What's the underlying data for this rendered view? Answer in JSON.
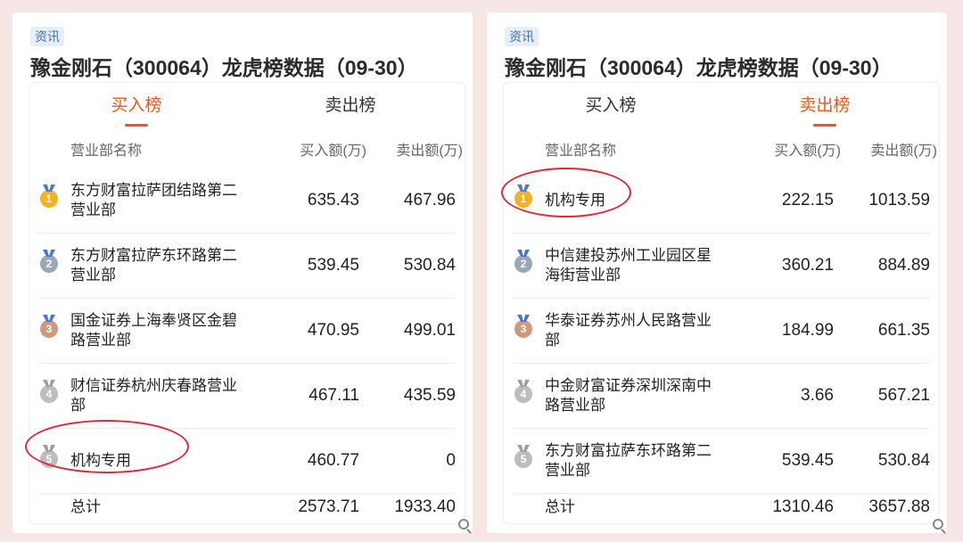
{
  "left_panel": {
    "tag": "资讯",
    "title": "豫金刚石（300064）龙虎榜数据（09-30）",
    "tabs": [
      "买入榜",
      "卖出榜"
    ],
    "active_tab": 0,
    "headers": {
      "name": "营业部名称",
      "buy": "买入额(万)",
      "sell": "卖出额(万)"
    },
    "rows": [
      {
        "rank": "1",
        "name": "东方财富拉萨团结路第二营业部",
        "buy": "635.43",
        "sell": "467.96"
      },
      {
        "rank": "2",
        "name": "东方财富拉萨东环路第二营业部",
        "buy": "539.45",
        "sell": "530.84"
      },
      {
        "rank": "3",
        "name": "国金证券上海奉贤区金碧路营业部",
        "buy": "470.95",
        "sell": "499.01"
      },
      {
        "rank": "4",
        "name": "财信证券杭州庆春路营业部",
        "buy": "467.11",
        "sell": "435.59"
      },
      {
        "rank": "5",
        "name": "机构专用",
        "buy": "460.77",
        "sell": "0"
      }
    ],
    "total": {
      "label": "总计",
      "buy": "2573.71",
      "sell": "1933.40"
    }
  },
  "right_panel": {
    "tag": "资讯",
    "title": "豫金刚石（300064）龙虎榜数据（09-30）",
    "tabs": [
      "买入榜",
      "卖出榜"
    ],
    "active_tab": 1,
    "headers": {
      "name": "营业部名称",
      "buy": "买入额(万)",
      "sell": "卖出额(万)"
    },
    "rows": [
      {
        "rank": "1",
        "name": "机构专用",
        "buy": "222.15",
        "sell": "1013.59"
      },
      {
        "rank": "2",
        "name": "中信建投苏州工业园区星海街营业部",
        "buy": "360.21",
        "sell": "884.89"
      },
      {
        "rank": "3",
        "name": "华泰证券苏州人民路营业部",
        "buy": "184.99",
        "sell": "661.35"
      },
      {
        "rank": "4",
        "name": "中金财富证券深圳深南中路营业部",
        "buy": "3.66",
        "sell": "567.21"
      },
      {
        "rank": "5",
        "name": "东方财富拉萨东环路第二营业部",
        "buy": "539.45",
        "sell": "530.84"
      }
    ],
    "total": {
      "label": "总计",
      "buy": "1310.46",
      "sell": "3657.88"
    }
  },
  "colors": {
    "accent": "#e25a1c",
    "highlight_circle": "#d9293a",
    "background": "#f7e6e6"
  },
  "icons": {
    "medals": [
      "gold-medal-icon",
      "silver-medal-icon",
      "bronze-medal-icon",
      "grey-medal-icon",
      "grey-medal-icon"
    ],
    "zoom": "zoom-in-icon"
  }
}
